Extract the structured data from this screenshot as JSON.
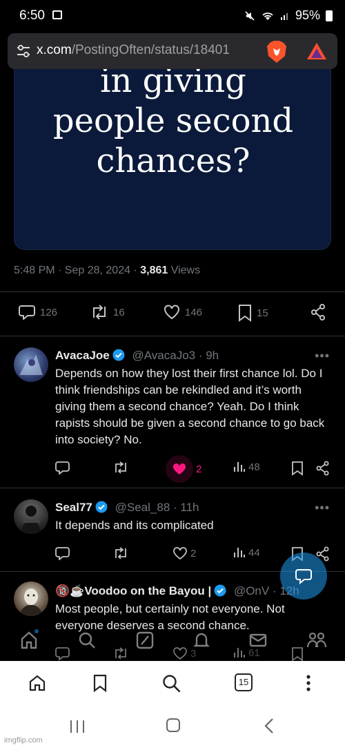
{
  "status_bar": {
    "time": "6:50",
    "battery": "95%"
  },
  "browser": {
    "url_domain": "x.com",
    "url_path": "/PostingOften/status/18401",
    "tab_count": "15"
  },
  "post": {
    "image_text_line1": "in giving",
    "image_text_line2": "people second",
    "image_text_line3": "chances?",
    "timestamp": "5:48 PM · Sep 28, 2024 · ",
    "views_count": "3,861",
    "views_label": " Views",
    "replies": "126",
    "reposts": "16",
    "likes": "146",
    "bookmarks": "15"
  },
  "replies": [
    {
      "name": "AvacaJoe",
      "handle": "@AvacaJo3 · 9h",
      "text": "Depends on how they lost their first chance lol. Do I think friendships can be rekindled and it’s worth giving them a second chance? Yeah. Do I think rapists should be given a second chance to go back into society? No.",
      "likes": "2",
      "views": "48"
    },
    {
      "name": "Seal77",
      "handle": "@Seal_88 · 11h",
      "text": "It depends and its complicated",
      "likes": "2",
      "views": "44"
    },
    {
      "name": "🔞☕Voodoo on the Bayou |",
      "handle": "@OnV · 12h",
      "text": "Most people, but certainly not everyone. Not everyone deserves a second chance.",
      "likes": "3",
      "views": "61"
    }
  ],
  "watermark": "imgflip.com",
  "colors": {
    "accent": "#1d9bf0",
    "like": "#f91880",
    "background": "#000000"
  }
}
